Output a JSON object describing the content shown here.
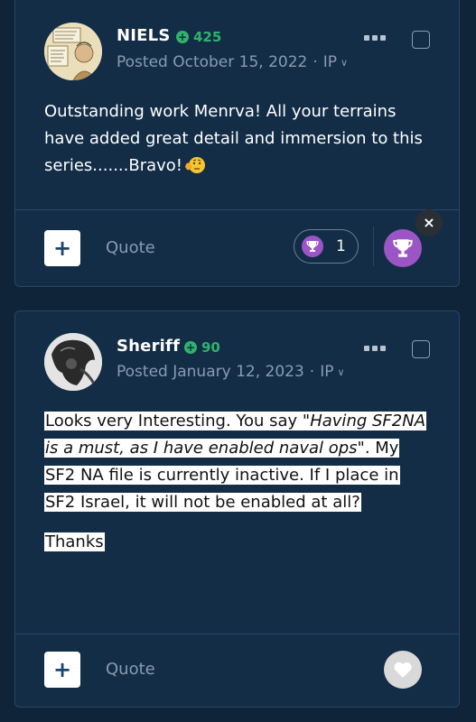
{
  "posts": [
    {
      "author": "NIELS",
      "reputation": "425",
      "posted": "Posted October 15, 2022",
      "ip_label": "IP",
      "content": "Outstanding work Menrva! All your terrains have added great detail and immersion to this series.......Bravo!",
      "quote_label": "Quote",
      "reaction_count": "1",
      "close_label": "×"
    },
    {
      "author": "Sheriff",
      "reputation": "90",
      "posted": "Posted January 12, 2023",
      "ip_label": "IP",
      "content_p1_a": "Looks very Interesting. You say \"",
      "content_p1_quote": "Having SF2NA is a must, as I have enabled naval ops",
      "content_p1_b": "\". My SF2 NA file is currently inactive. If I place in SF2 Israel, it will not be enabled at all?",
      "content_p2": "Thanks",
      "quote_label": "Quote"
    }
  ],
  "icons": {
    "reputation": "plus-circle-icon",
    "menu": "ellipsis-icon",
    "reaction": "trophy-icon",
    "like": "heart-icon",
    "emoji": "thinking-face-emoji-icon"
  },
  "colors": {
    "background": "#0f2438",
    "card": "#132d47",
    "reputation": "#2fb36a",
    "reaction": "#9b55c4",
    "muted": "#8a9bb0"
  }
}
